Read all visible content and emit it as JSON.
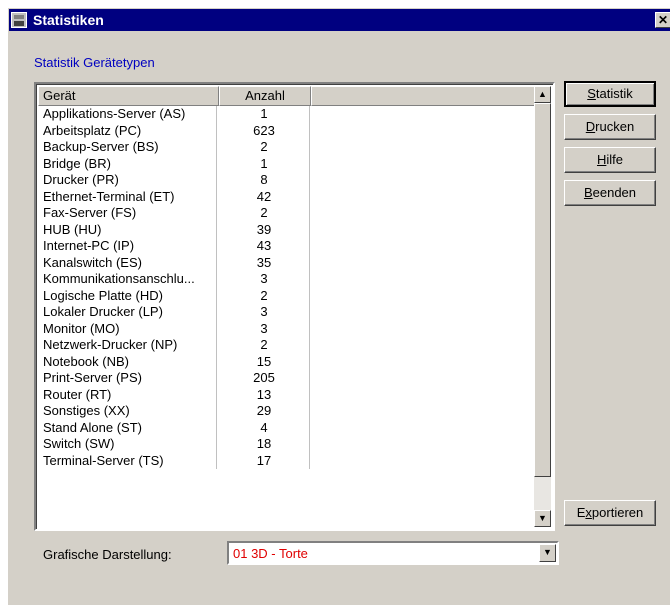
{
  "window": {
    "title": "Statistiken",
    "close": "✕"
  },
  "section_label": "Statistik Gerätetypen",
  "table": {
    "columns": [
      "Gerät",
      "Anzahl",
      ""
    ],
    "rows": [
      [
        "Applikations-Server (AS)",
        "1"
      ],
      [
        "Arbeitsplatz (PC)",
        "623"
      ],
      [
        "Backup-Server (BS)",
        "2"
      ],
      [
        "Bridge (BR)",
        "1"
      ],
      [
        "Drucker (PR)",
        "8"
      ],
      [
        "Ethernet-Terminal (ET)",
        "42"
      ],
      [
        "Fax-Server (FS)",
        "2"
      ],
      [
        "HUB (HU)",
        "39"
      ],
      [
        "Internet-PC (IP)",
        "43"
      ],
      [
        "Kanalswitch (ES)",
        "35"
      ],
      [
        "Kommunikationsanschlu...",
        "3"
      ],
      [
        "Logische Platte (HD)",
        "2"
      ],
      [
        "Lokaler Drucker (LP)",
        "3"
      ],
      [
        "Monitor (MO)",
        "3"
      ],
      [
        "Netzwerk-Drucker (NP)",
        "2"
      ],
      [
        "Notebook (NB)",
        "15"
      ],
      [
        "Print-Server (PS)",
        "205"
      ],
      [
        "Router (RT)",
        "13"
      ],
      [
        "Sonstiges (XX)",
        "29"
      ],
      [
        "Stand Alone (ST)",
        "4"
      ],
      [
        "Switch (SW)",
        "18"
      ],
      [
        "Terminal-Server (TS)",
        "17"
      ]
    ]
  },
  "buttons": {
    "statistik": "Statistik",
    "drucken": "Drucken",
    "hilfe": "Hilfe",
    "beenden": "Beenden",
    "exportieren": "Exportieren"
  },
  "grafik": {
    "label": "Grafische Darstellung:",
    "value": "01  3D - Torte"
  },
  "icons": {
    "scroll_up": "up-arrow-icon",
    "scroll_down": "down-arrow-icon",
    "dropdown": "dropdown-arrow-icon"
  },
  "colors": {
    "titlebar": "#000080",
    "section_label": "#0000c0",
    "select_value": "#e00000"
  }
}
